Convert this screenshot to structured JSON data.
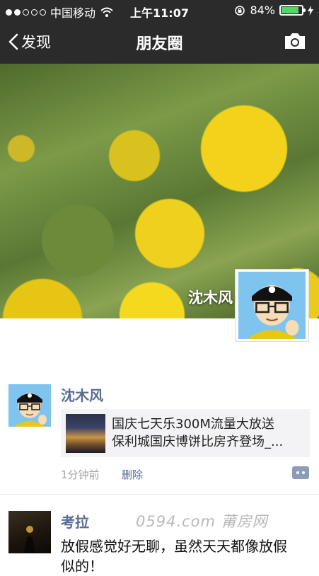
{
  "status_bar": {
    "carrier": "中国移动",
    "time": "上午11:07",
    "battery": "84%",
    "battery_level": 0.84,
    "signal_dots": 5,
    "signal_filled": 2
  },
  "nav": {
    "back_label": "发现",
    "title": "朋友圈",
    "camera_icon": "camera-icon"
  },
  "cover": {
    "user_name": "沈木风"
  },
  "posts": [
    {
      "name": "沈木风",
      "link_line1": "国庆七天乐300M流量大放送",
      "link_line2": "保利城国庆博饼比房齐登场_...",
      "time": "1分钟前",
      "delete_label": "删除"
    },
    {
      "name": "考拉",
      "text_line1": "放假感觉好无聊，虽然天天都像放假",
      "text_line2": "似的！"
    }
  ],
  "watermark": "0594.com 莆房网",
  "colors": {
    "bar_bg": "#2b2b2b",
    "link_blue": "#576b95",
    "battery_green": "#4cd964"
  }
}
